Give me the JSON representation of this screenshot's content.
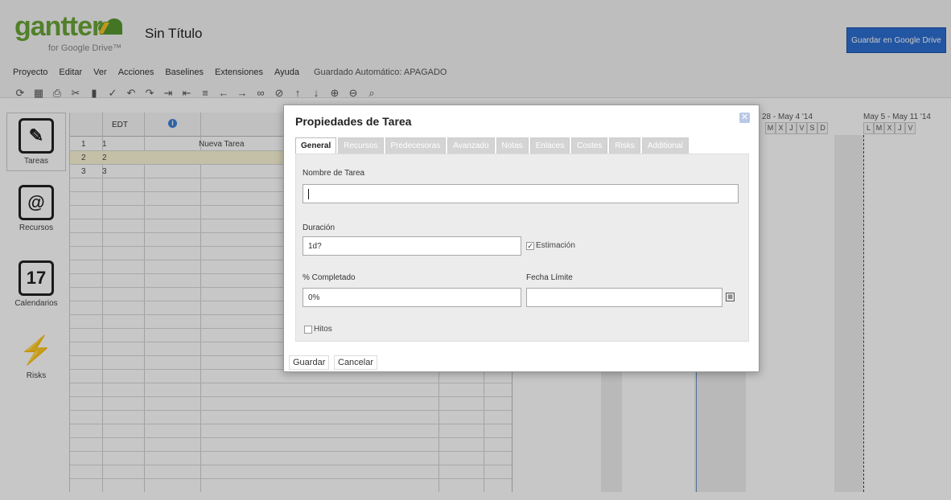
{
  "header": {
    "logo_text": "gantter",
    "logo_subtitle": "for Google Drive™",
    "doc_title": "Sin Título",
    "save_drive_label": "Guardar en Google Drive"
  },
  "menu": {
    "items": [
      "Proyecto",
      "Editar",
      "Ver",
      "Acciones",
      "Baselines",
      "Extensiones",
      "Ayuda"
    ],
    "autosave": "Guardado Automático: APAGADO"
  },
  "toolbar": {
    "icons": [
      "refresh-icon",
      "table-icon",
      "print-icon",
      "cut-icon",
      "paste-icon",
      "format-icon",
      "undo-icon",
      "redo-icon",
      "indent-icon",
      "outdent-icon",
      "link-icon",
      "left-arrow-icon",
      "right-arrow-icon",
      "link-tasks-icon",
      "unlink-tasks-icon",
      "up-arrow-icon",
      "down-arrow-icon",
      "zoom-in-icon",
      "zoom-out-icon",
      "zoom-fit-icon"
    ]
  },
  "sidebar": {
    "items": [
      {
        "label": "Tareas",
        "icon": "edit-icon"
      },
      {
        "label": "Recursos",
        "icon": "address-book-icon"
      },
      {
        "label": "Calendarios",
        "icon": "calendar-icon",
        "day": "17"
      },
      {
        "label": "Risks",
        "icon": "lightning-icon"
      }
    ]
  },
  "grid": {
    "col_edt": "EDT",
    "rows": [
      {
        "n": "1",
        "edt": "1",
        "task": "Nueva Tarea"
      },
      {
        "n": "2",
        "edt": "2",
        "task": ""
      },
      {
        "n": "3",
        "edt": "3",
        "task": ""
      }
    ]
  },
  "gantt": {
    "week1": "28 - May 4 '14",
    "week1_days": [
      "M",
      "X",
      "J",
      "V",
      "S",
      "D"
    ],
    "week2": "May 5 - May 11 '14",
    "week2_days": [
      "L",
      "M",
      "X",
      "J",
      "V"
    ]
  },
  "modal": {
    "title": "Propiedades de Tarea",
    "tabs": [
      "General",
      "Recursos",
      "Predecesoras",
      "Avanzado",
      "Notas",
      "Enlaces",
      "Costes",
      "Risks",
      "Additional"
    ],
    "task_name_label": "Nombre de Tarea",
    "task_name_value": "",
    "duration_label": "Duración",
    "duration_value": "1d?",
    "estimate_label": "Estimación",
    "complete_label": "% Completado",
    "complete_value": "0%",
    "deadline_label": "Fecha Límite",
    "deadline_value": "",
    "milestone_label": "Hitos",
    "save_label": "Guardar",
    "cancel_label": "Cancelar"
  }
}
